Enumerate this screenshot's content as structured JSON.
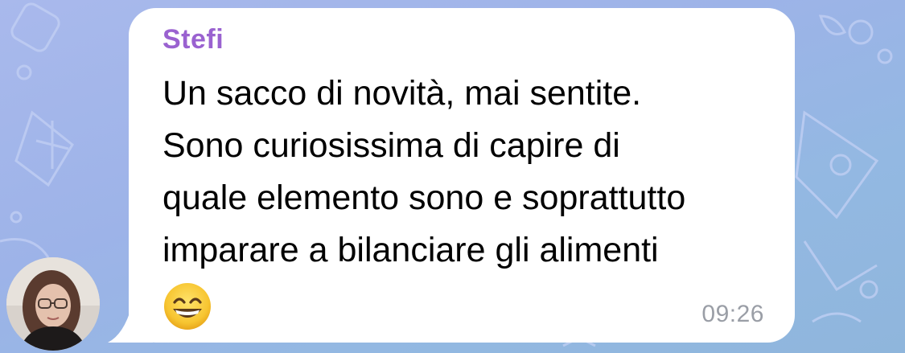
{
  "chat": {
    "sender_name": "Stefi",
    "message_lines": [
      "Un sacco di novità, mai sentite.",
      "Sono curiosissima di capire di",
      "quale elemento sono e soprattutto",
      "imparare a bilanciare gli alimenti"
    ],
    "emoji": "grinning-face-with-smiling-eyes",
    "time": "09:26"
  },
  "colors": {
    "sender_name": "#9a62d0",
    "bubble": "#ffffff",
    "timestamp": "#9a9ea6",
    "wallpaper": "#a3b8e8"
  }
}
